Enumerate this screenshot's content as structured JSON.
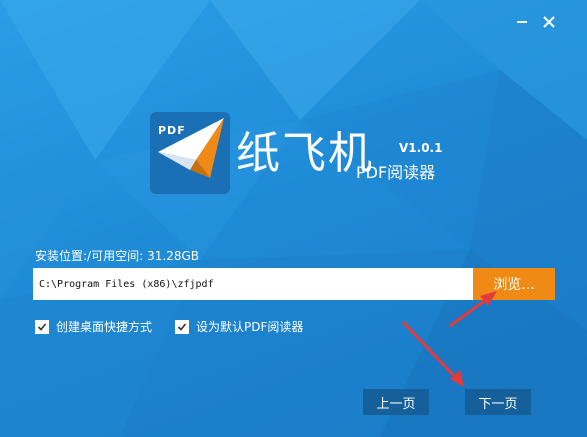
{
  "app": {
    "logo_text": "PDF",
    "name_cn": "纸飞机",
    "version": "V1.0.1",
    "subtitle": "PDF阅读器"
  },
  "install": {
    "location_label": "安装位置:/可用空间:",
    "free_space": "31.28GB",
    "path_value": "C:\\Program Files (x86)\\zfjpdf",
    "browse_label": "浏览..."
  },
  "options": [
    {
      "label": "创建桌面快捷方式",
      "checked": true
    },
    {
      "label": "设为默认PDF阅读器",
      "checked": true
    }
  ],
  "nav": {
    "prev_label": "上一页",
    "next_label": "下一页"
  },
  "colors": {
    "accent": "#ef8a15",
    "background": "#1f8bd6",
    "annotation_arrow": "#e53a3a"
  },
  "icons": {
    "minimize": "minimize-icon",
    "close": "close-icon",
    "logo": "paper-plane-logo-icon",
    "checkbox": "checkmark-icon"
  }
}
